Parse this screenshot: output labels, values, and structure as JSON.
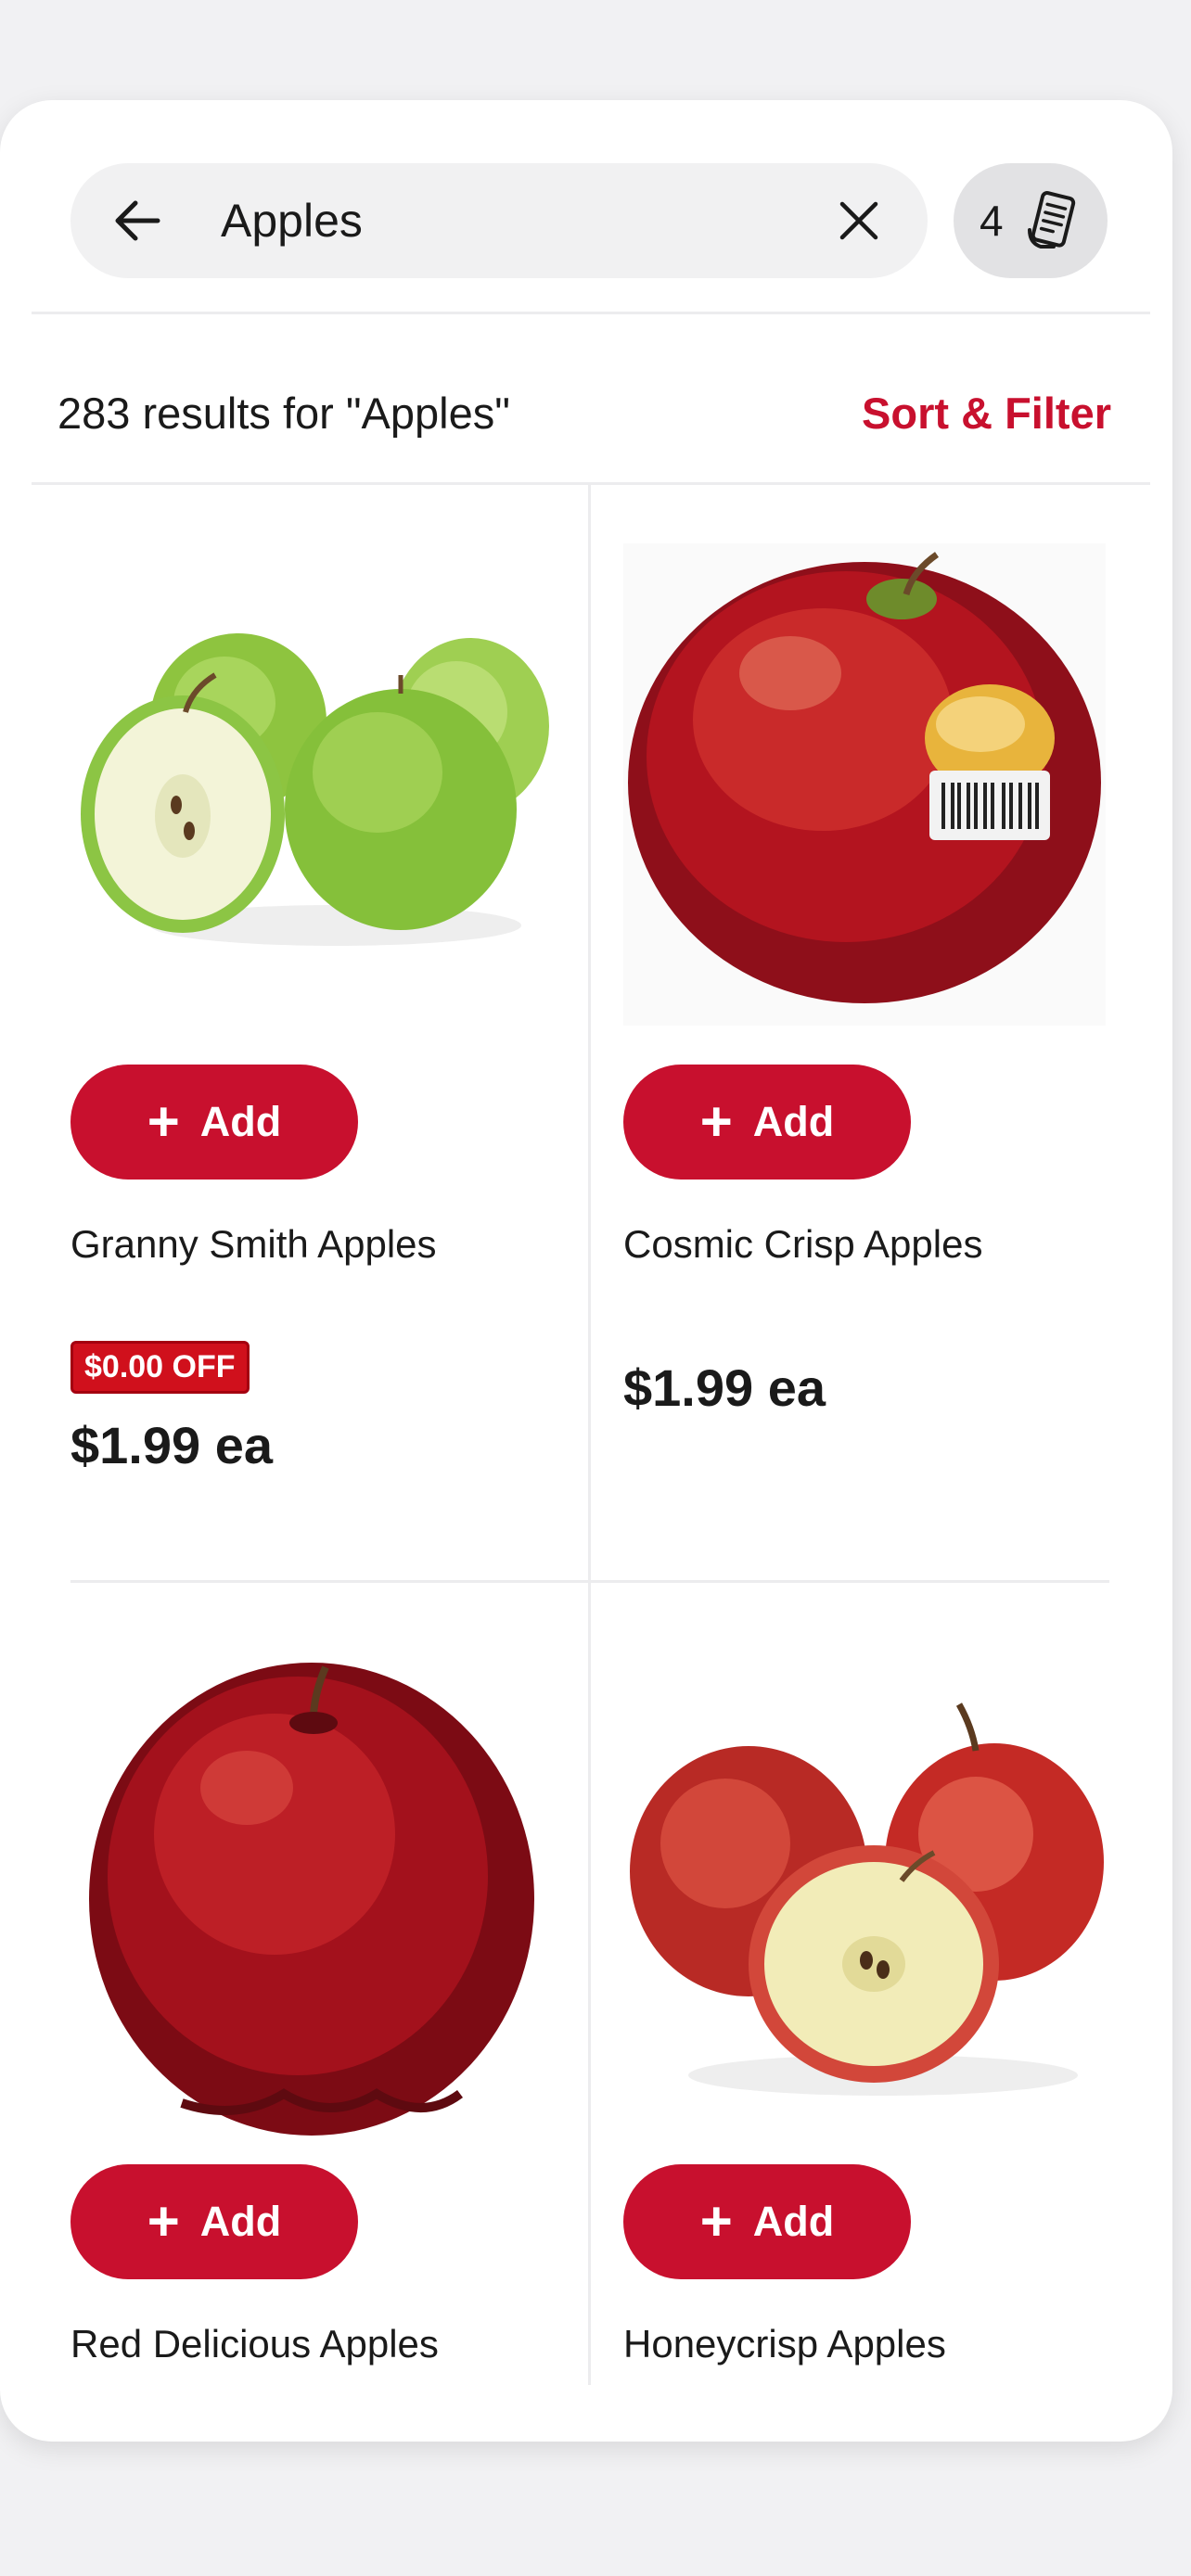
{
  "search": {
    "query": "Apples",
    "list_count": "4"
  },
  "results": {
    "summary": "283 results for \"Apples\"",
    "sort_filter_label": "Sort & Filter"
  },
  "products": [
    {
      "name": "Granny Smith Apples",
      "add_label": "Add",
      "badge": "$0.00 OFF",
      "price": "$1.99 ea"
    },
    {
      "name": "Cosmic Crisp Apples",
      "add_label": "Add",
      "price": "$1.99 ea"
    },
    {
      "name": "Red Delicious Apples",
      "add_label": "Add"
    },
    {
      "name": "Honeycrisp Apples",
      "add_label": "Add"
    }
  ],
  "colors": {
    "accent": "#c8102e",
    "badge": "#d0101c",
    "page_bg": "#f1f1f3"
  },
  "icons": {
    "back": "arrow-left-icon",
    "clear": "close-icon",
    "list": "shopping-list-icon",
    "add": "plus-icon"
  }
}
